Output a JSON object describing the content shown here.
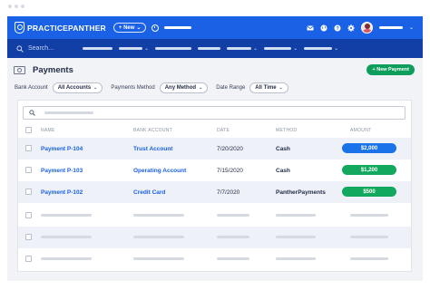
{
  "brand": {
    "logo_text": "PRACTICEPANTHER"
  },
  "topbar": {
    "new_button": "+ New",
    "icons": [
      "envelope-icon",
      "globe-icon",
      "help-icon",
      "settings-icon"
    ]
  },
  "search": {
    "placeholder": "Search..."
  },
  "page": {
    "title": "Payments",
    "new_payment_button": "+ New Payment"
  },
  "filters": [
    {
      "label": "Bank Account",
      "value": "All Accounts"
    },
    {
      "label": "Payments Method",
      "value": "Any Method"
    },
    {
      "label": "Date Range",
      "value": "All Time"
    }
  ],
  "table": {
    "columns": [
      "NAME",
      "BANK ACCOUNT",
      "DATE",
      "METHOD",
      "AMOUNT"
    ],
    "rows": [
      {
        "name": "Payment P-104",
        "bank_account": "Trust Account",
        "date": "7/20/2020",
        "method": "Cash",
        "amount": "$2,000",
        "amount_color": "#1a73e8"
      },
      {
        "name": "Payment P-103",
        "bank_account": "Operating Account",
        "date": "7/15/2020",
        "method": "Cash",
        "amount": "$1,200",
        "amount_color": "#12a85e"
      },
      {
        "name": "Payment P-102",
        "bank_account": "Credit Card",
        "date": "7/7/2020",
        "method": "PantherPayments",
        "amount": "$500",
        "amount_color": "#12a85e"
      }
    ]
  },
  "colors": {
    "topbar": "#1a61e6",
    "searchbar": "#113fa6",
    "accent_green": "#0d9e5b",
    "link_blue": "#1a61e6"
  }
}
